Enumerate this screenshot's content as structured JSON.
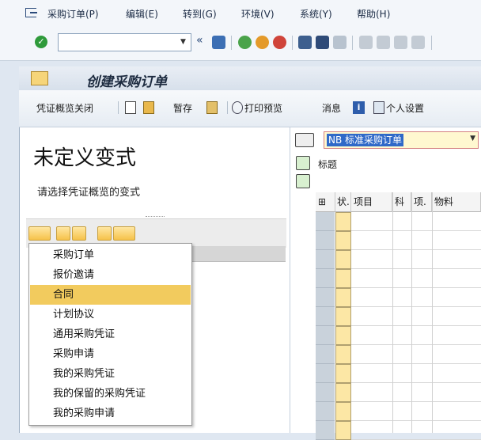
{
  "menubar": {
    "items": [
      {
        "label": "采购订单(P)"
      },
      {
        "label": "编辑(E)"
      },
      {
        "label": "转到(G)"
      },
      {
        "label": "环境(V)"
      },
      {
        "label": "系统(Y)"
      },
      {
        "label": "帮助(H)"
      }
    ]
  },
  "toolbar": {
    "command_value": ""
  },
  "window": {
    "title": "创建采购订单"
  },
  "app_toolbar": {
    "doc_overview_off": "凭证概览关闭",
    "hold": "暂存",
    "print_preview": "打印预览",
    "messages": "消息",
    "personal_settings": "个人设置"
  },
  "left_pane": {
    "heading": "未定义变式",
    "subtitle": "请选择凭证概览的变式",
    "menu": [
      {
        "label": "采购订单",
        "selected": false
      },
      {
        "label": "报价邀请",
        "selected": false
      },
      {
        "label": "合同",
        "selected": true
      },
      {
        "label": "计划协议",
        "selected": false
      },
      {
        "label": "通用采购凭证",
        "selected": false
      },
      {
        "label": "采购申请",
        "selected": false
      },
      {
        "label": "我的采购凭证",
        "selected": false
      },
      {
        "label": "我的保留的采购凭证",
        "selected": false
      },
      {
        "label": "我的采购申请",
        "selected": false
      }
    ]
  },
  "right_pane": {
    "doc_type": "NB 标准采购订单",
    "header_label": "标题",
    "grid_columns": [
      "状.",
      "项目",
      "科",
      "项.",
      "物料"
    ]
  },
  "colors": {
    "selected_menu": "#f2cb5e",
    "window_bg": "#ffffff",
    "accent": "#2f69c8"
  }
}
